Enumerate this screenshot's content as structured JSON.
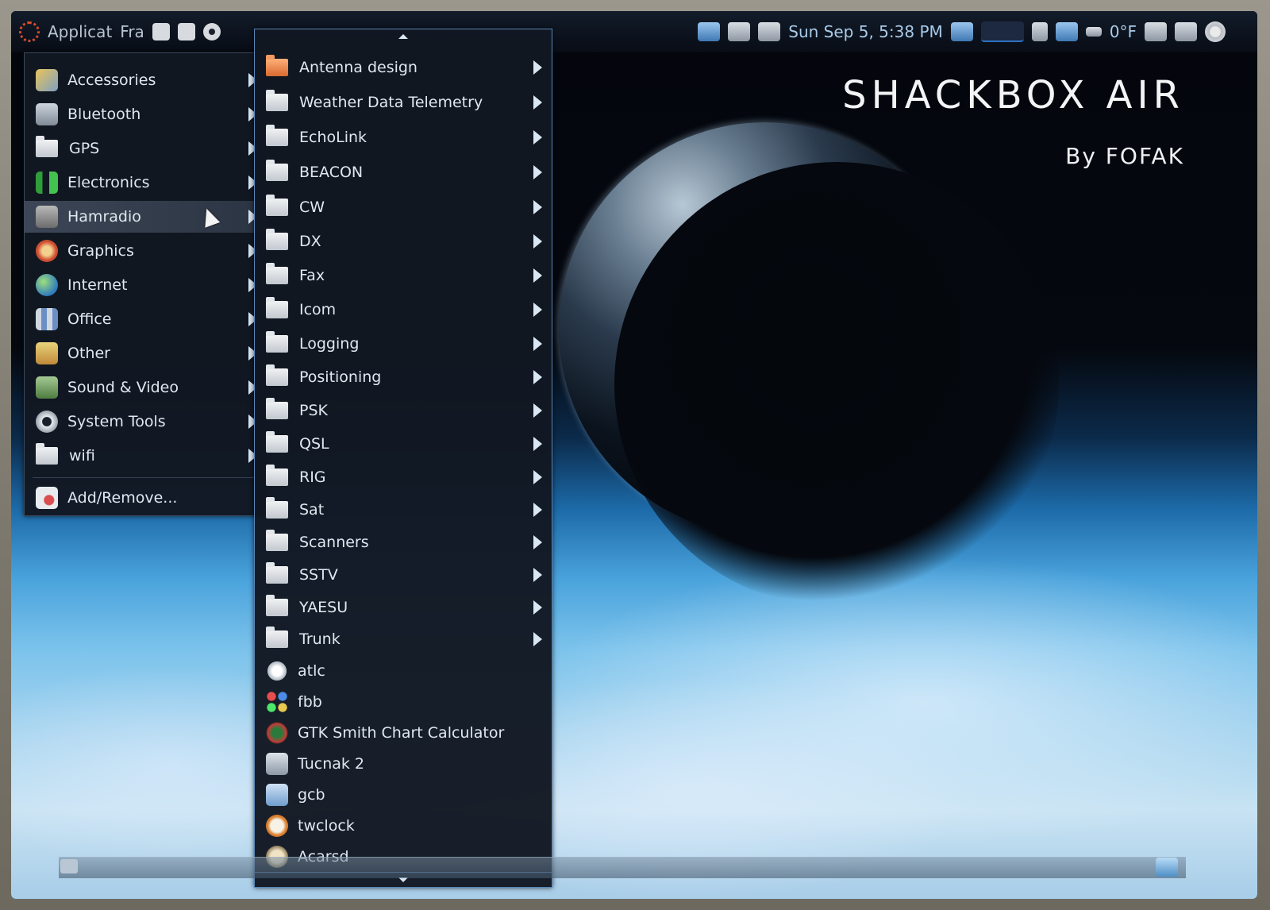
{
  "panel": {
    "applications_label": "Applicat",
    "places_label": "Fra",
    "clock": "Sun Sep  5,  5:38 PM",
    "temperature": "0°F"
  },
  "brand": {
    "title": "SHACKBOX AIR",
    "byline": "By FOFAK"
  },
  "main_menu": {
    "items": [
      {
        "label": "Accessories",
        "icon": "accessories-icon"
      },
      {
        "label": "Bluetooth",
        "icon": "bluetooth-icon"
      },
      {
        "label": "GPS",
        "icon": "folder-icon"
      },
      {
        "label": "Electronics",
        "icon": "electronics-icon"
      },
      {
        "label": "Hamradio",
        "icon": "hamradio-icon"
      },
      {
        "label": "Graphics",
        "icon": "graphics-icon"
      },
      {
        "label": "Internet",
        "icon": "globe-icon"
      },
      {
        "label": "Office",
        "icon": "office-icon"
      },
      {
        "label": "Other",
        "icon": "other-icon"
      },
      {
        "label": "Sound & Video",
        "icon": "media-icon"
      },
      {
        "label": "System Tools",
        "icon": "gear-icon"
      },
      {
        "label": "wifi",
        "icon": "folder-icon"
      }
    ],
    "add_remove": "Add/Remove..."
  },
  "sub_menu": {
    "folders": [
      "Antenna design",
      "Weather Data Telemetry",
      "EchoLink",
      "BEACON",
      "CW",
      "DX",
      "Fax",
      "Icom",
      "Logging",
      "Positioning",
      "PSK",
      "QSL",
      "RIG",
      "Sat",
      "Scanners",
      "SSTV",
      "YAESU",
      "Trunk"
    ],
    "apps": [
      "atlc",
      "fbb",
      "GTK Smith Chart Calculator",
      "Tucnak 2",
      "gcb",
      "twclock",
      "Acarsd"
    ]
  },
  "colors": {
    "menu_bg": "#121822",
    "menu_text": "#dfe7ef",
    "highlight": "#3c4656",
    "submenu_border": "#5a86b8"
  }
}
